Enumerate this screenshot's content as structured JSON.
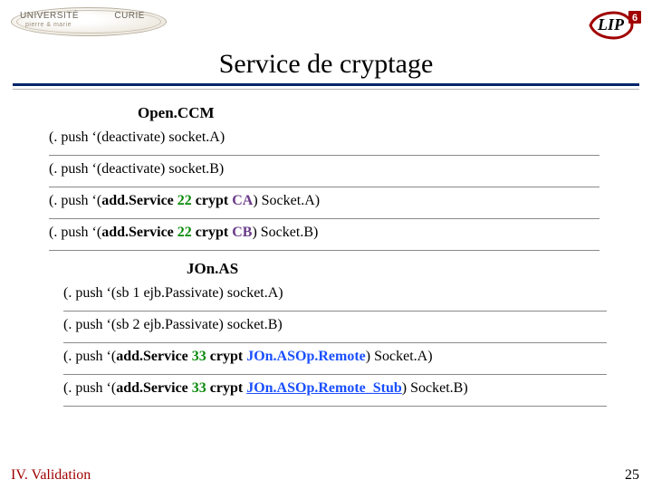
{
  "header": {
    "upmc_line1": "UNIVERSITÉ",
    "upmc_line1b": "CURIE",
    "upmc_line2": "pierre & marie",
    "lip_text": "LIP",
    "lip_badge": "6"
  },
  "title": "Service de cryptage",
  "openccm": {
    "label": "Open.CCM",
    "lines": [
      {
        "pre": "(. push ‘(deactivate) socket.A)"
      },
      {
        "pre": "(. push ‘(deactivate) socket.B)"
      },
      {
        "p1": "(. push ‘(",
        "cmd": "add.Service ",
        "num": "22",
        "mid": " crypt ",
        "arg": "CA",
        "post": ") Socket.A)"
      },
      {
        "p1": "(. push ‘(",
        "cmd": "add.Service  ",
        "num": "22",
        "mid": " crypt ",
        "arg": "CB",
        "post": ") Socket.B)"
      }
    ]
  },
  "jonas": {
    "label": "JOn.AS",
    "lines": [
      {
        "pre": "(. push ‘(sb 1 ejb.Passivate) socket.A)"
      },
      {
        "pre": "(. push ‘(sb 2 ejb.Passivate) socket.B)"
      },
      {
        "p1": "(. push ‘(",
        "cmd": "add.Service ",
        "num": "33",
        "mid": " crypt ",
        "arg": "JOn.ASOp.Remote",
        "post": ") Socket.A)"
      },
      {
        "p1": "(. push ‘(",
        "cmd": "add.Service ",
        "num": "33",
        "mid": " crypt ",
        "arg": "JOn.ASOp.Remote_Stub",
        "post": ") Socket.B)"
      }
    ]
  },
  "footer": {
    "left": "IV. Validation",
    "page": "25"
  }
}
